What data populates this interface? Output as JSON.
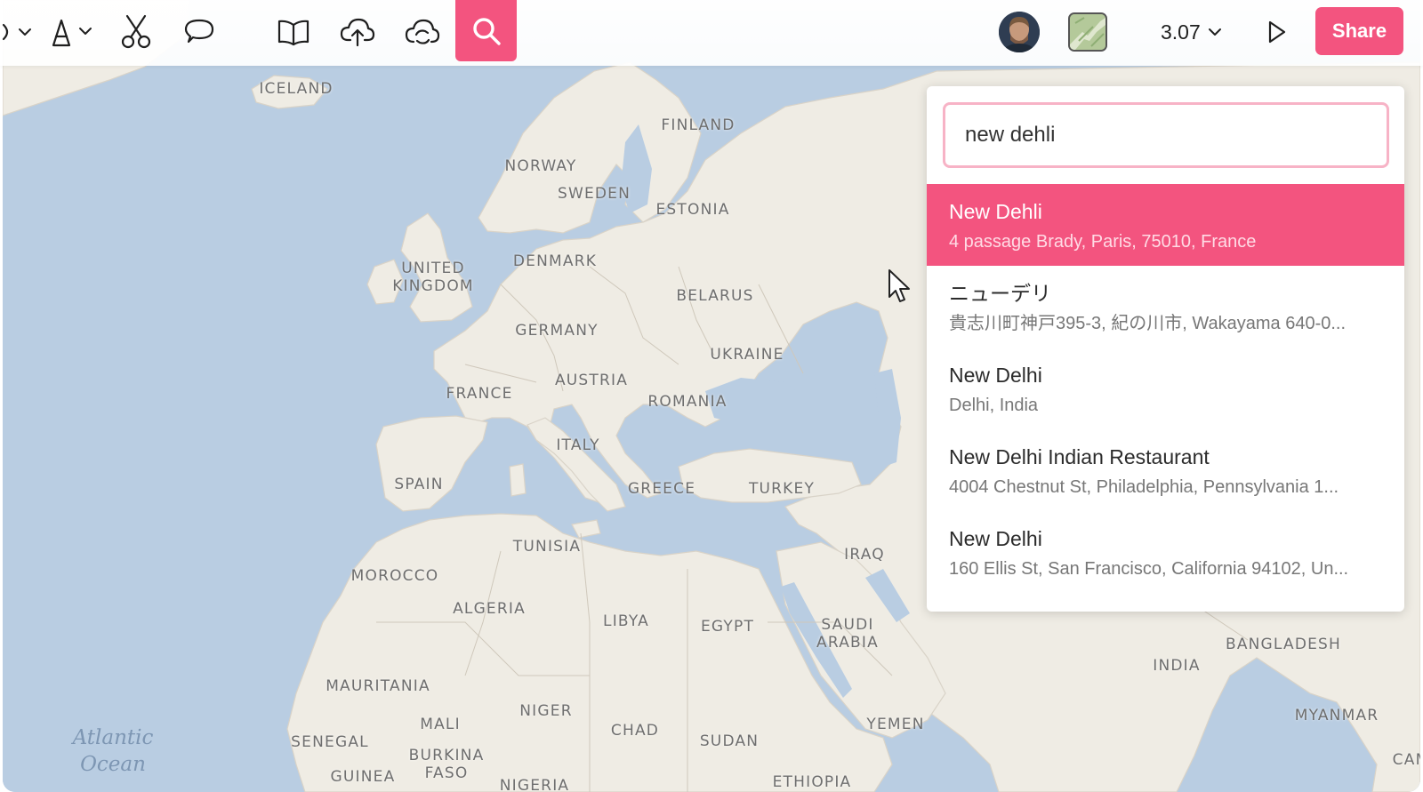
{
  "toolbar": {
    "zoom_value": "3.07",
    "share_label": "Share",
    "icons": [
      "pen-dropdown-icon",
      "text-tool-icon",
      "scissors-icon",
      "comment-icon",
      "book-icon",
      "upload-cloud-icon",
      "cloud-sync-icon",
      "search-icon",
      "play-icon"
    ]
  },
  "search": {
    "query": "new dehli",
    "results": [
      {
        "title": "New Dehli",
        "subtitle": "4 passage Brady, Paris, 75010, France",
        "active": true
      },
      {
        "title": "ニューデリ",
        "subtitle": "貴志川町神戸395-3, 紀の川市, Wakayama 640-0...",
        "active": false
      },
      {
        "title": "New Delhi",
        "subtitle": "Delhi, India",
        "active": false
      },
      {
        "title": "New Delhi Indian Restaurant",
        "subtitle": "4004 Chestnut St, Philadelphia, Pennsylvania 1...",
        "active": false
      },
      {
        "title": "New Delhi",
        "subtitle": "160 Ellis St, San Francisco, California 94102, Un...",
        "active": false
      }
    ]
  },
  "map": {
    "colors": {
      "water": "#b9cde2",
      "land": "#efece4",
      "accent": "#f3547f"
    },
    "labels": {
      "iceland": "ICELAND",
      "finland": "FINLAND",
      "norway": "NORWAY",
      "sweden": "SWEDEN",
      "estonia": "ESTONIA",
      "united_kingdom": "UNITED\nKINGDOM",
      "denmark": "DENMARK",
      "belarus": "BELARUS",
      "germany": "GERMANY",
      "ukraine": "UKRAINE",
      "austria": "AUSTRIA",
      "france": "FRANCE",
      "romania": "ROMANIA",
      "italy": "ITALY",
      "spain": "SPAIN",
      "greece": "GREECE",
      "turkey": "TURKEY",
      "tunisia": "TUNISIA",
      "morocco": "MOROCCO",
      "iraq": "IRAQ",
      "algeria": "ALGERIA",
      "libya": "LIBYA",
      "egypt": "EGYPT",
      "saudi_arabia": "SAUDI\nARABIA",
      "bangladesh": "BANGLADESH",
      "india": "INDIA",
      "mauritania": "MAURITANIA",
      "niger": "NIGER",
      "chad": "CHAD",
      "mali": "MALI",
      "myanmar": "MYANMAR",
      "senegal": "SENEGAL",
      "sudan": "SUDAN",
      "yemen": "YEMEN",
      "burkina_faso": "BURKINA\nFASO",
      "guinea": "GUINEA",
      "nigeria": "NIGERIA",
      "ethiopia": "ETHIOPIA",
      "cambodia_partial": "CAMB",
      "atlantic_ocean": "Atlantic\nOcean"
    }
  }
}
